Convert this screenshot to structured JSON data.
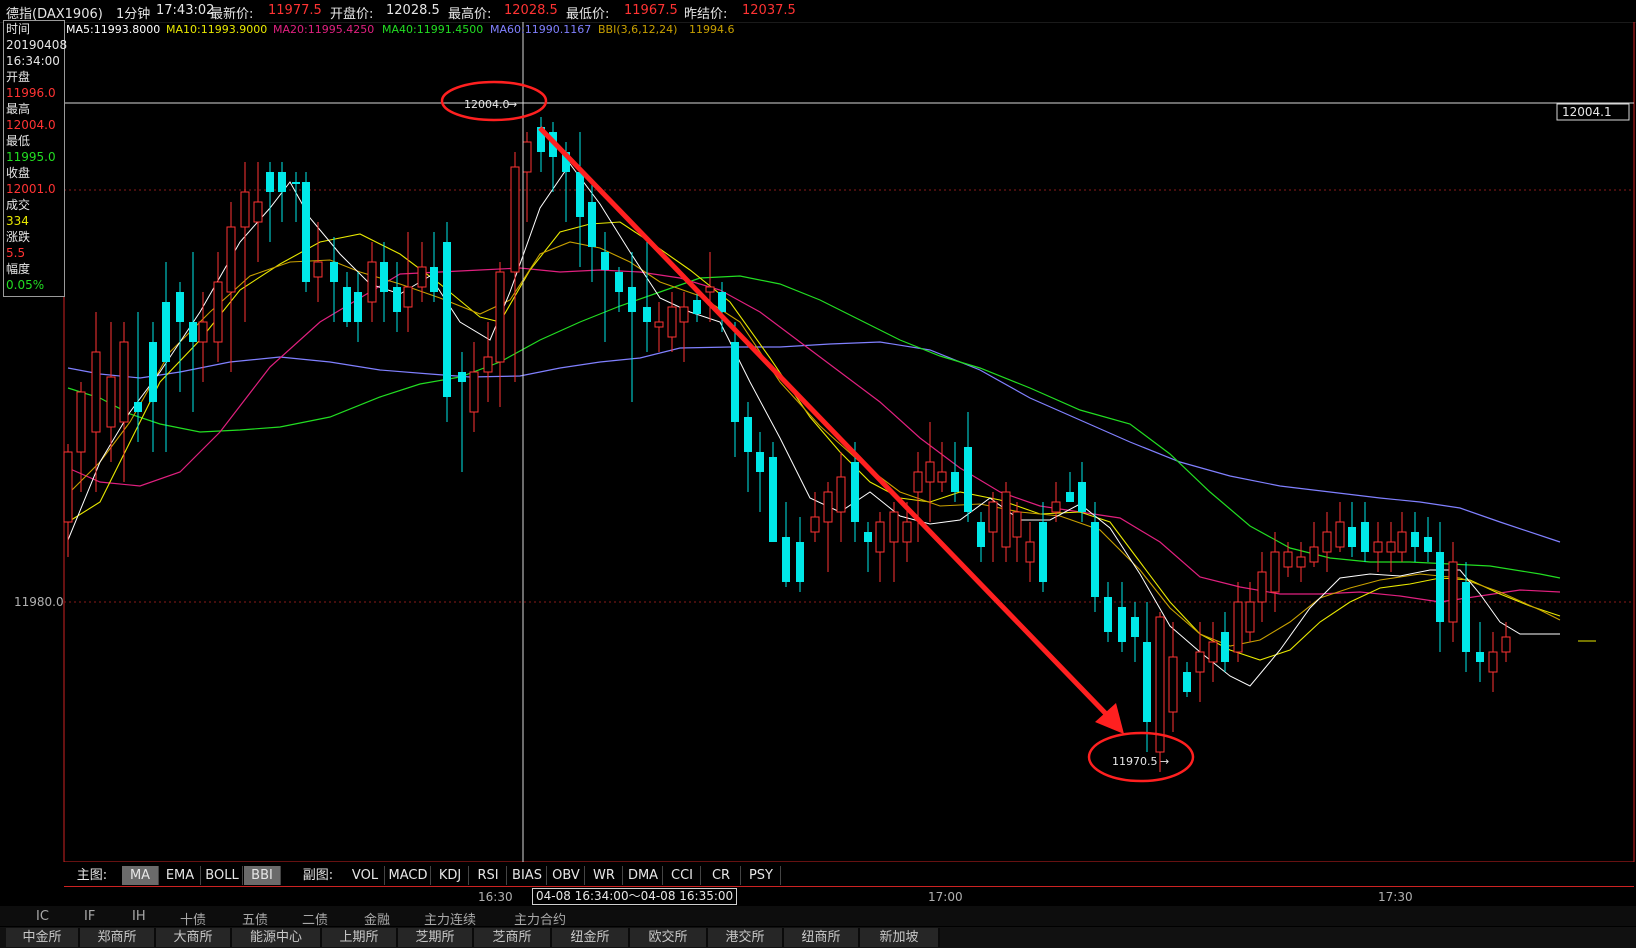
{
  "header": {
    "symbol": "德指(DAX1906)",
    "period": "1分钟",
    "time": "17:43:02",
    "latest_label": "最新价:",
    "latest_value": "11977.5",
    "open_label": "开盘价:",
    "open_value": "12028.5",
    "high_label": "最高价:",
    "high_value": "12028.5",
    "low_label": "最低价:",
    "low_value": "11967.5",
    "prev_label": "昨结价:",
    "prev_value": "12037.5"
  },
  "ma_legend": {
    "ma5": "MA5:11993.8000",
    "ma10": "MA10:11993.9000",
    "ma20": "MA20:11995.4250",
    "ma40": "MA40:11991.4500",
    "ma60": "MA60:11990.1167",
    "bbi": "BBI(3,6,12,24)",
    "bbi_value": "11994.6",
    "colors": {
      "ma5": "#ffffff",
      "ma10": "#e8e800",
      "ma20": "#e0207f",
      "ma40": "#22dd22",
      "ma60": "#8080ff",
      "bbi": "#c8a000"
    }
  },
  "infobox": {
    "time_label": "时间",
    "date": "20190408",
    "clock": "16:34:00",
    "open_label": "开盘",
    "open": "11996.0",
    "high_label": "最高",
    "high": "12004.0",
    "low_label": "最低",
    "low": "11995.0",
    "close_label": "收盘",
    "close": "12001.0",
    "vol_label": "成交",
    "vol": "334",
    "chg_label": "涨跌",
    "chg": "5.5",
    "amp_label": "幅度",
    "amp": "0.05%"
  },
  "chart": {
    "y_tick_label": "11980.0",
    "crosshair_price": "12004.1",
    "max_marker": "12004.0",
    "min_marker": "11970.5",
    "colors": {
      "up": "#ff3333",
      "down": "#00e8e8",
      "annotation": "#ff2020",
      "grid": "#8b1a1a"
    }
  },
  "chart_data": {
    "type": "candlestick",
    "title": "德指(DAX1906) 1分钟",
    "y_tick": 11980.0,
    "annotated_high": 12004.0,
    "annotated_low": 11970.5,
    "crosshair_price": 12004.1,
    "x_ticks": [
      "16:30",
      "17:00",
      "17:30"
    ],
    "series": [
      {
        "name": "MA5",
        "last": 11993.8
      },
      {
        "name": "MA10",
        "last": 11993.9
      },
      {
        "name": "MA20",
        "last": 11995.425
      },
      {
        "name": "MA40",
        "last": 11991.45
      },
      {
        "name": "MA60",
        "last": 11990.1167
      },
      {
        "name": "BBI(3,6,12,24)",
        "last": 11994.6
      }
    ]
  },
  "indicators": {
    "main_label": "主图:",
    "main": [
      "MA",
      "EMA",
      "BOLL",
      "BBI"
    ],
    "main_active": [
      "MA",
      "BBI"
    ],
    "sub_label": "副图:",
    "sub": [
      "VOL",
      "MACD",
      "KDJ",
      "RSI",
      "BIAS",
      "OBV",
      "WR",
      "DMA",
      "CCI",
      "CR",
      "PSY"
    ]
  },
  "time_axis": {
    "t1": "16:30",
    "range": "04-08 16:34:00～04-08 16:35:00",
    "t2": "17:00",
    "t3": "17:30"
  },
  "tabs_row1": [
    "IC",
    "IF",
    "IH",
    "十债",
    "五债",
    "二债",
    "金融",
    "主力连续",
    "主力合约"
  ],
  "tabs_row2": [
    "中金所",
    "郑商所",
    "大商所",
    "能源中心",
    "上期所",
    "芝期所",
    "芝商所",
    "纽金所",
    "欧交所",
    "港交所",
    "纽商所",
    "新加坡"
  ]
}
